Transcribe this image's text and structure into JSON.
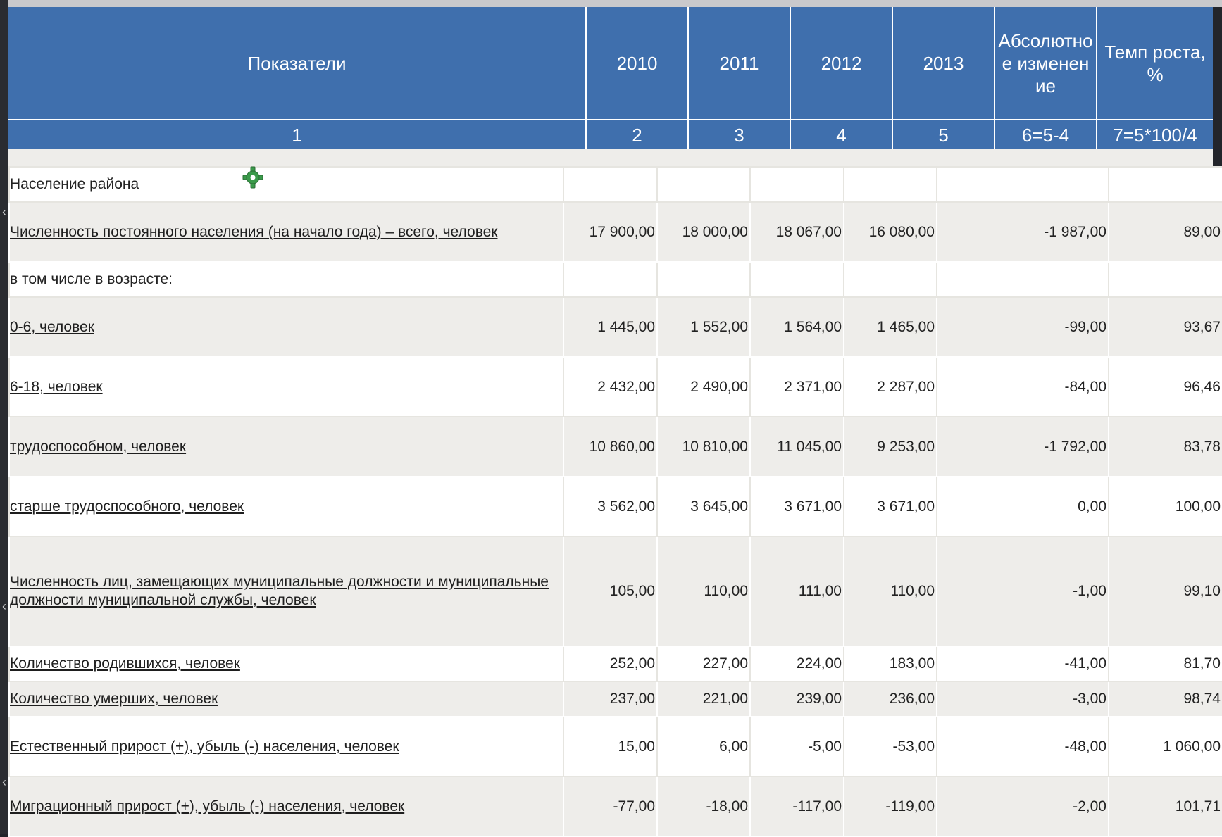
{
  "header": {
    "columns": [
      "Показатели",
      "2010",
      "2011",
      "2012",
      "2013",
      "Абсолютно е изменен ие",
      "Темп роста, %"
    ],
    "numbers": [
      "1",
      "2",
      "3",
      "4",
      "5",
      "6=5-4",
      "7=5*100/4"
    ]
  },
  "section_title": "Население района",
  "rows": [
    {
      "label": "Численность постоянного населения (на начало года) – всего, человек",
      "values": [
        "17 900,00",
        "18 000,00",
        "18 067,00",
        "16 080,00",
        "-1 987,00",
        "89,00"
      ]
    },
    {
      "label": "в том числе в возрасте:",
      "values": [
        "",
        "",
        "",
        "",
        "",
        ""
      ]
    },
    {
      "label": "0-6, человек",
      "values": [
        "1 445,00",
        "1 552,00",
        "1 564,00",
        "1 465,00",
        "-99,00",
        "93,67"
      ]
    },
    {
      "label": "6-18, человек",
      "values": [
        "2 432,00",
        "2 490,00",
        "2 371,00",
        "2 287,00",
        "-84,00",
        "96,46"
      ]
    },
    {
      "label": "трудоспособном, человек",
      "values": [
        "10 860,00",
        "10 810,00",
        "11 045,00",
        "9 253,00",
        "-1 792,00",
        "83,78"
      ]
    },
    {
      "label": "старше трудоспособного, человек",
      "values": [
        "3 562,00",
        "3 645,00",
        "3 671,00",
        "3 671,00",
        "0,00",
        "100,00"
      ]
    },
    {
      "label": "Численность лиц, замещающих муниципальные должности и муниципальные должности муниципальной службы, человек",
      "values": [
        "105,00",
        "110,00",
        "111,00",
        "110,00",
        "-1,00",
        "99,10"
      ]
    },
    {
      "label": "Количество родившихся, человек",
      "values": [
        "252,00",
        "227,00",
        "224,00",
        "183,00",
        "-41,00",
        "81,70"
      ]
    },
    {
      "label": "Количество умерших, человек",
      "values": [
        "237,00",
        "221,00",
        "239,00",
        "236,00",
        "-3,00",
        "98,74"
      ]
    },
    {
      "label": "Естественный прирост (+), убыль (-) населения, человек",
      "values": [
        "15,00",
        "6,00",
        "-5,00",
        "-53,00",
        "-48,00",
        "1 060,00"
      ]
    },
    {
      "label": "Миграционный прирост (+), убыль (-) населения, человек",
      "values": [
        "-77,00",
        "-18,00",
        "-117,00",
        "-119,00",
        "-2,00",
        "101,71"
      ]
    }
  ],
  "icons": {
    "gear": "gear-icon"
  },
  "colors": {
    "header_bg": "#3f6fad",
    "row_grey": "#eeedea",
    "row_white": "#ffffff"
  }
}
